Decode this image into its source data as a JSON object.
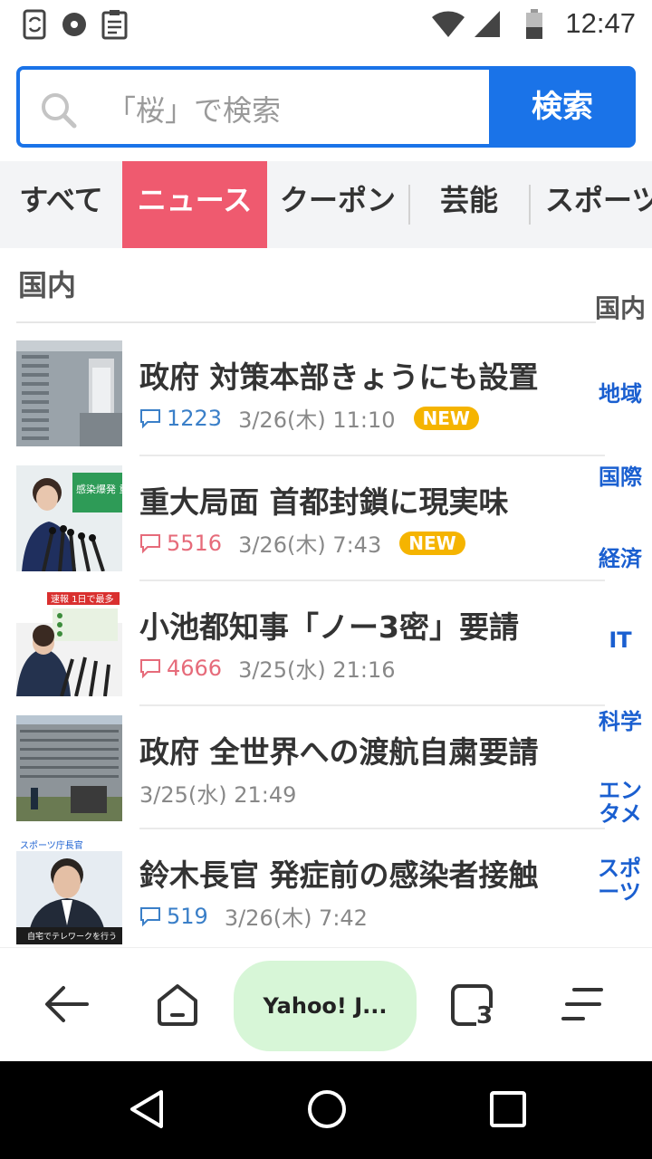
{
  "status_bar": {
    "time": "12:47",
    "icons": [
      "sync-icon",
      "disc-icon",
      "clipboard-icon",
      "wifi-icon",
      "signal-icon",
      "battery-icon"
    ]
  },
  "search": {
    "placeholder": "「桜」で検索",
    "button_label": "検索"
  },
  "tabs": [
    {
      "label": "すべて",
      "active": false
    },
    {
      "label": "ニュース",
      "active": true
    },
    {
      "label": "クーポン",
      "active": false
    },
    {
      "label": "芸能",
      "active": false
    },
    {
      "label": "スポーツ",
      "active": false
    }
  ],
  "section": {
    "title": "国内"
  },
  "side_index": {
    "current": "国内",
    "items": [
      "地域",
      "国際",
      "経済",
      "IT",
      "科学",
      "エンタメ",
      "スポーツ"
    ]
  },
  "articles": [
    {
      "title": "政府 対策本部きょうにも設置",
      "comments": "1223",
      "comment_color": "blue",
      "date": "3/26(木) 11:10",
      "new": "NEW"
    },
    {
      "title": "重大局面 首都封鎖に現実味",
      "comments": "5516",
      "comment_color": "red",
      "date": "3/26(木) 7:43",
      "new": "NEW"
    },
    {
      "title": "小池都知事「ノー3密」要請",
      "comments": "4666",
      "comment_color": "red",
      "date": "3/25(水) 21:16",
      "new": ""
    },
    {
      "title": "政府 全世界への渡航自粛要請",
      "comments": "",
      "comment_color": "",
      "date": "3/25(水) 21:49",
      "new": ""
    },
    {
      "title": "鈴木長官 発症前の感染者接触",
      "comments": "519",
      "comment_color": "blue",
      "date": "3/26(木) 7:42",
      "new": ""
    }
  ],
  "thumbnail_text": {
    "t2": "感染爆発 重",
    "t3": "速報 1日で最多",
    "t5_top": "スポーツ庁長官",
    "t5_bottom": "自宅でテレワークを行う"
  },
  "browser_bar": {
    "tab_title": "Yahoo! J...",
    "tab_count": "3"
  },
  "colors": {
    "accent": "#1a73e8",
    "active_tab": "#ef5a6f",
    "new_badge": "#f5b400",
    "link": "#1a5fd0"
  }
}
